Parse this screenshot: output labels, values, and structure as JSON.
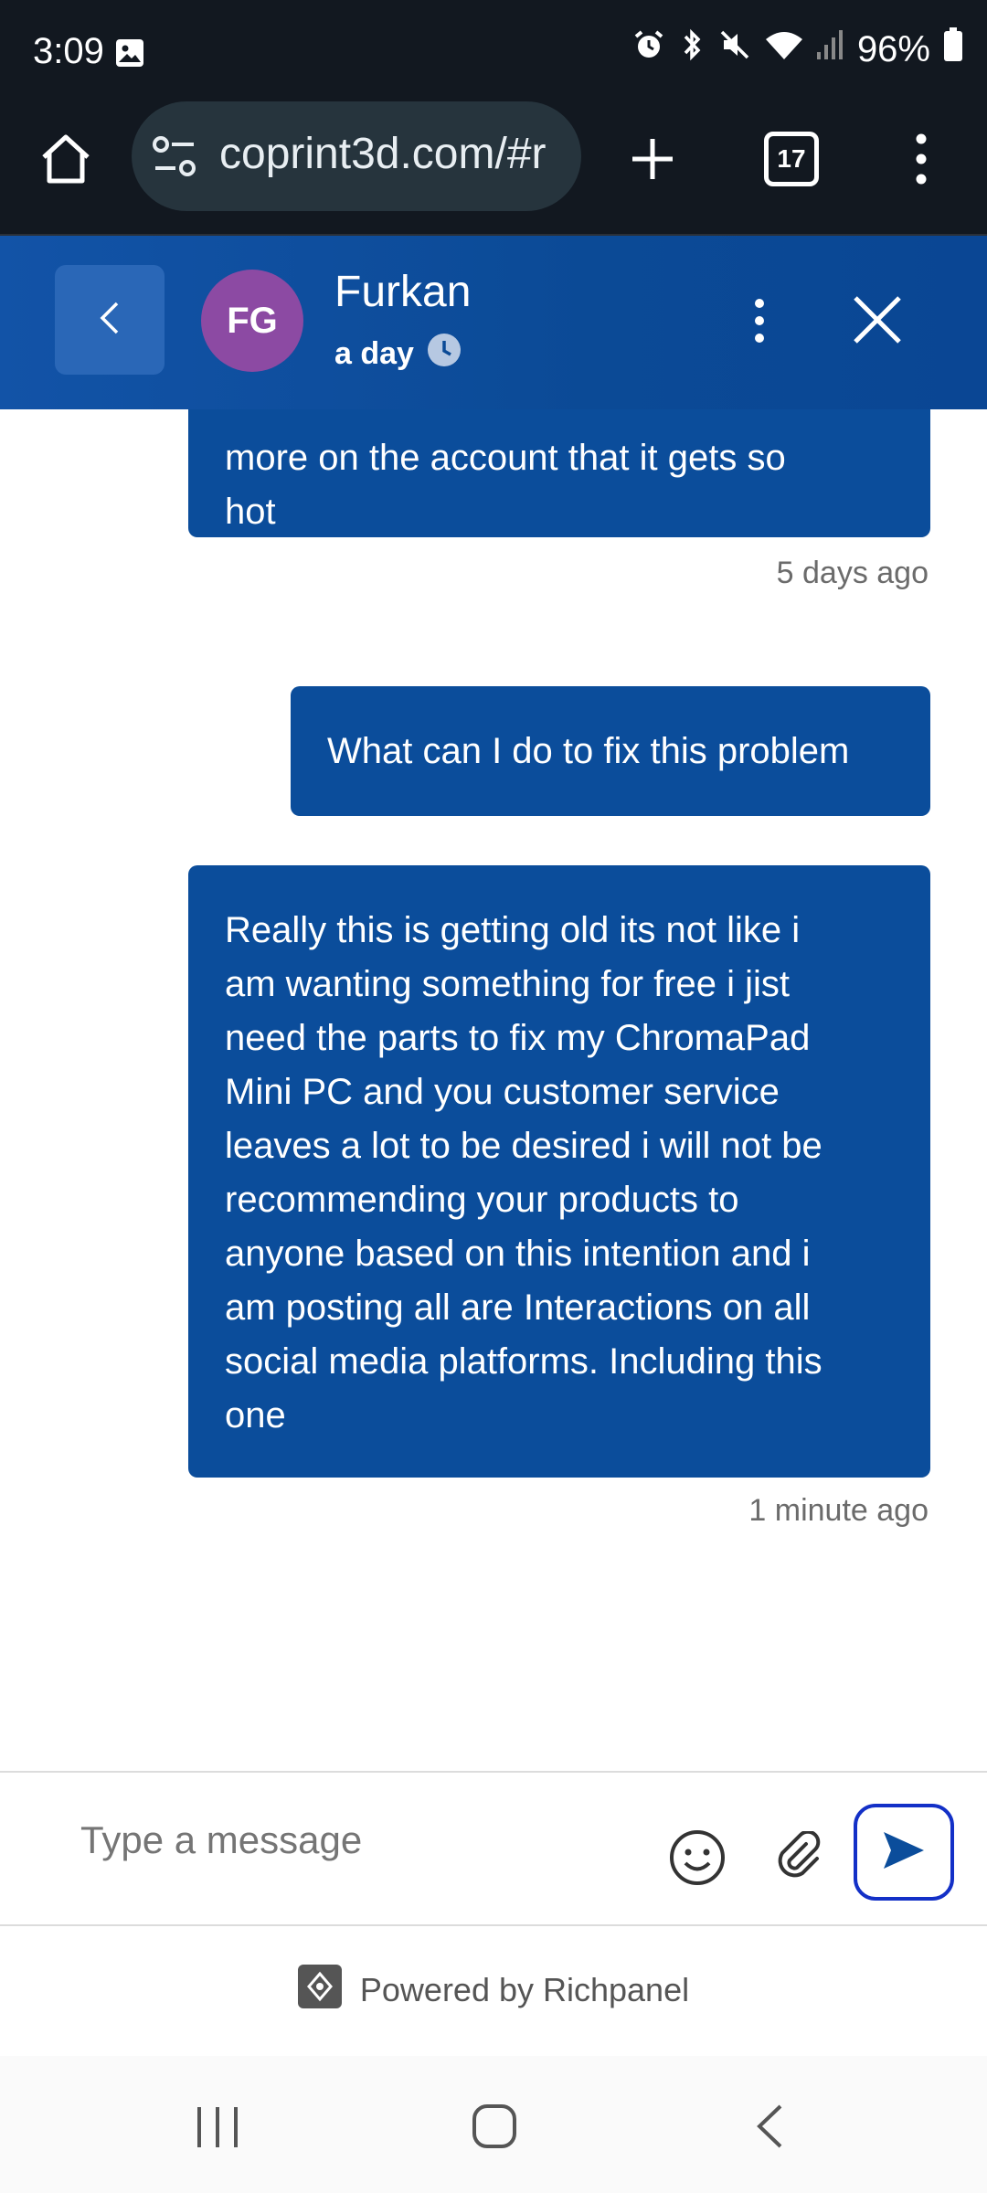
{
  "status_bar": {
    "time": "3:09",
    "battery": "96%",
    "icons": [
      "image-icon",
      "alarm-icon",
      "bluetooth-icon",
      "mute-icon",
      "wifi-icon",
      "signal-icon",
      "battery-icon"
    ]
  },
  "browser": {
    "url": "coprint3d.com/#r",
    "tab_count": "17",
    "icons": [
      "home-icon",
      "site-settings-icon",
      "new-tab-icon",
      "tabs-icon",
      "more-icon"
    ]
  },
  "chat_header": {
    "avatar_initials": "FG",
    "agent_name": "Furkan",
    "response_time": "a day",
    "colors": {
      "header": "#0b4a96",
      "avatar": "#8c4aa3"
    }
  },
  "messages": [
    {
      "text": "more on the account that it gets so hot",
      "lines": [
        "more on the account that it gets so",
        "hot"
      ],
      "timestamp": "5 days ago"
    },
    {
      "text": "What can I do to fix this problem",
      "lines": [
        "What can I do to fix this problem"
      ],
      "timestamp": ""
    },
    {
      "text": "Really this is getting old its not like i am wanting something for free i jist need the parts to fix my ChromaPad Mini PC and you customer service leaves a lot to be desired i will not be recommending your products to anyone based on this intention and i am posting all are Interactions on all social media platforms. Including this one",
      "lines": [
        "Really this is getting old its not like i",
        "am wanting something for free i jist",
        "need the parts to fix my ChromaPad",
        "Mini PC and you customer service",
        "leaves a lot to be desired i will not be",
        "recommending your products to",
        "anyone based on this intention and i",
        "am posting all are Interactions on all",
        "social media platforms. Including this",
        "one"
      ],
      "timestamp": "1 minute ago"
    }
  ],
  "composer": {
    "placeholder": "Type a message",
    "value": ""
  },
  "footer": {
    "powered_by": "Powered by Richpanel"
  },
  "colors": {
    "bubble": "#0b4d9b",
    "send_border": "#1330c7",
    "status_bg": "#121820"
  }
}
